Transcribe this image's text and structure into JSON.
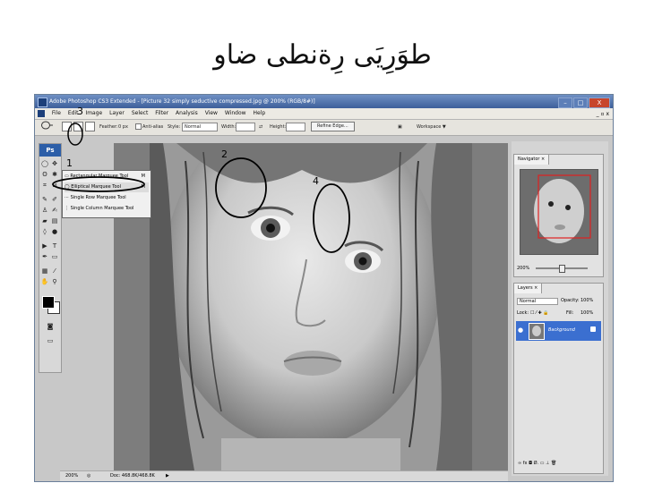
{
  "slide": {
    "title": "طوَرِيَى رِةنطى ضاو"
  },
  "window": {
    "title": "Adobe Photoshop CS3 Extended - [Picture 32 simply seductive compressed.jpg @ 200% (RGB/8#)]",
    "controls": [
      "–",
      "□",
      "X"
    ]
  },
  "menubar": {
    "items": [
      "File",
      "Edit",
      "Image",
      "Layer",
      "Select",
      "Filter",
      "Analysis",
      "View",
      "Window",
      "Help"
    ],
    "doc_controls": "_ ▫ x"
  },
  "options_bar": {
    "feather_label": "Feather:",
    "feather_value": "0 px",
    "antialias_label": "Anti-alias",
    "style_label": "Style:",
    "style_value": "Normal",
    "width_label": "Width:",
    "height_label": "Height:",
    "refine_edge_label": "Refine Edge...",
    "workspace_label": "Workspace ▼"
  },
  "toolbox": {
    "badge": "Ps",
    "collapse": "◂◂"
  },
  "flyout": {
    "items": [
      {
        "label": "Rectangular Marquee Tool",
        "key": "M"
      },
      {
        "label": "Elliptical Marquee Tool",
        "key": "M"
      },
      {
        "label": "Single Row Marquee Tool",
        "key": ""
      },
      {
        "label": "Single Column Marquee Tool",
        "key": ""
      }
    ]
  },
  "navigator": {
    "tab": "Navigator ×",
    "zoom": "200%"
  },
  "layers": {
    "tab": "Layers ×",
    "blend_mode": "Normal",
    "opacity_label": "Opacity:",
    "opacity_value": "100%",
    "lock_label": "Lock:",
    "fill_label": "Fill:",
    "fill_value": "100%",
    "layer_name": "Background",
    "footer_icons": "∞ fx ◘ Ø. ▭ ⊥ 🗑"
  },
  "statusbar": {
    "zoom": "200%",
    "doc": "Doc: 468.8K/468.8K"
  },
  "annotations": {
    "n1": "1",
    "n2": "2",
    "n3": "3",
    "n4": "4"
  }
}
